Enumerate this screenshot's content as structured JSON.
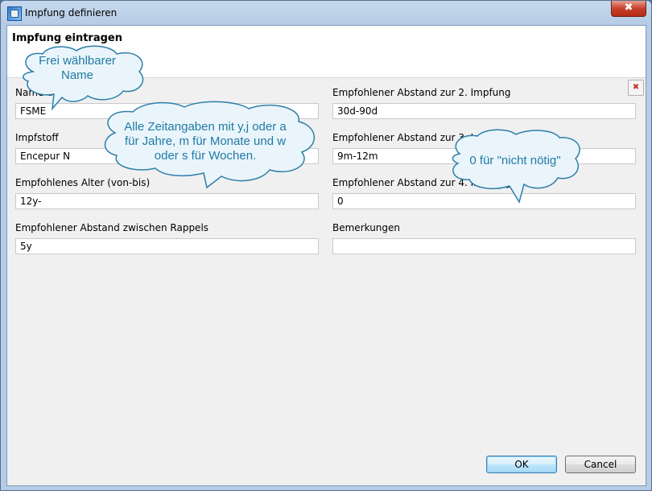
{
  "window": {
    "title": "Impfung definieren",
    "close_glyph": "✖"
  },
  "page": {
    "title": "Impfung eintragen"
  },
  "form": {
    "name": {
      "label": "Name der Impfung",
      "value": "FSME"
    },
    "vaccine": {
      "label": "Impfstoff",
      "value": "Encepur N"
    },
    "age": {
      "label": "Empfohlenes Alter (von-bis)",
      "value": "12y-"
    },
    "booster_interval": {
      "label": "Empfohlener Abstand zwischen Rappels",
      "value": "5y"
    },
    "interval_2": {
      "label": "Empfohlener Abstand zur 2. Impfung",
      "value": "30d-90d"
    },
    "interval_3": {
      "label": "Empfohlener Abstand zur 3. Impfung",
      "value": "9m-12m"
    },
    "interval_4": {
      "label": "Empfohlener Abstand zur 4. Impfung",
      "value": "0"
    },
    "remarks": {
      "label": "Bemerkungen",
      "value": ""
    }
  },
  "callouts": {
    "name_hint": {
      "line1": "Frei wählbarer",
      "line2": "Name"
    },
    "time_hint": {
      "line1": "Alle Zeitangaben mit y,j oder a",
      "line2": "für Jahre, m für Monate und w",
      "line3": "oder s für Wochen."
    },
    "zero_hint": {
      "text": "0 für \"nicht nötig\""
    }
  },
  "buttons": {
    "ok": "OK",
    "cancel": "Cancel"
  },
  "colors": {
    "bubble_fill": "#eaf5fb",
    "bubble_stroke": "#2d7ea8",
    "bubble_text": "#1f7aa4"
  },
  "icons": {
    "app": "vaccine-app-icon",
    "dismiss": "dismiss-x-icon"
  }
}
